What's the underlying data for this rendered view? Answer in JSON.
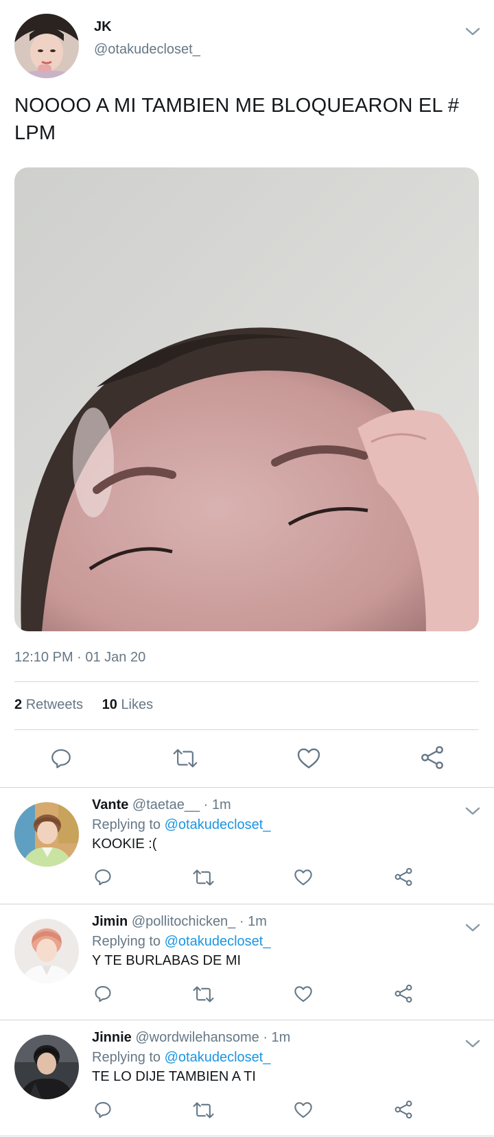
{
  "main_tweet": {
    "author_name": "JK",
    "author_handle": "@otakudecloset_",
    "text": "NOOOO A MI TAMBIEN ME BLOQUEARON EL # LPM",
    "timestamp": "12:10 PM · 01 Jan 20",
    "retweets_count": "2",
    "retweets_label": "Retweets",
    "likes_count": "10",
    "likes_label": "Likes"
  },
  "replies": [
    {
      "name": "Vante",
      "handle": "@taetae__",
      "time": "· 1m",
      "replying_prefix": "Replying to",
      "replying_to": "@otakudecloset_",
      "text": "KOOKIE :("
    },
    {
      "name": "Jimin",
      "handle": "@pollitochicken_",
      "time": "· 1m",
      "replying_prefix": "Replying to",
      "replying_to": "@otakudecloset_",
      "text": "Y TE BURLABAS DE MI"
    },
    {
      "name": "Jinnie",
      "handle": "@wordwilehansome",
      "time": "· 1m",
      "replying_prefix": "Replying to",
      "replying_to": "@otakudecloset_",
      "text": "TE LO DIJE TAMBIEN A TI"
    }
  ],
  "icons": {
    "reply": "reply-icon",
    "retweet": "retweet-icon",
    "like": "heart-icon",
    "share": "share-icon",
    "menu": "chevron-down-icon"
  },
  "colors": {
    "text_primary": "#14171a",
    "text_secondary": "#657786",
    "link": "#1b95e0",
    "divider": "#ccd6dd"
  }
}
